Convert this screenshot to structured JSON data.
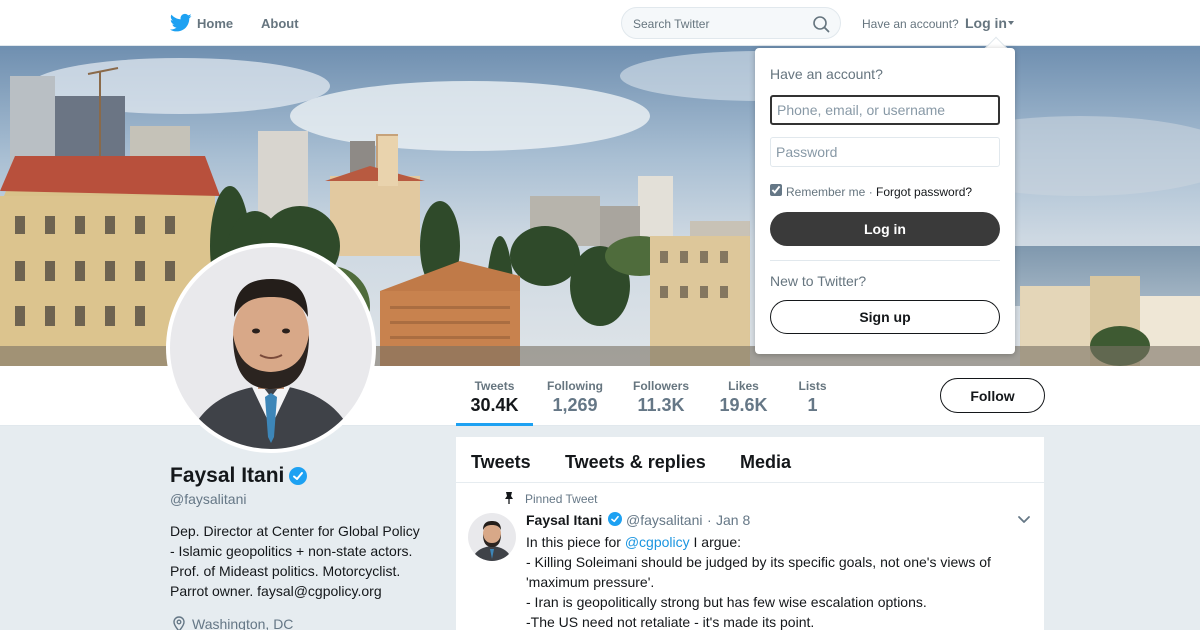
{
  "nav": {
    "home_label": "Home",
    "about_label": "About",
    "search_placeholder": "Search Twitter",
    "have_account": "Have an account?",
    "login_label": "Log in",
    "logo_icon": "twitter-bird-icon",
    "accent_color": "#1da1f2"
  },
  "profile": {
    "name": "Faysal Itani",
    "handle": "@faysalitani",
    "bio_lines": [
      "Dep. Director at Center for Global Policy",
      "- Islamic geopolitics + non-state actors.",
      "Prof. of Mideast politics. Motorcyclist.",
      "Parrot owner. faysal@cgpolicy.org"
    ],
    "location": "Washington, DC",
    "verified": true
  },
  "stats": [
    {
      "label": "Tweets",
      "value": "30.4K",
      "active": true
    },
    {
      "label": "Following",
      "value": "1,269"
    },
    {
      "label": "Followers",
      "value": "11.3K"
    },
    {
      "label": "Likes",
      "value": "19.6K"
    },
    {
      "label": "Lists",
      "value": "1"
    }
  ],
  "follow_label": "Follow",
  "timeline": {
    "tabs": [
      "Tweets",
      "Tweets & replies",
      "Media"
    ]
  },
  "pinned_tweet": {
    "pinned_label": "Pinned Tweet",
    "name": "Faysal Itani",
    "handle": "@faysalitani",
    "separator": "·",
    "date": "Jan 8",
    "text_line1_prefix": "In this piece for ",
    "text_line1_mention": "@cgpolicy",
    "text_line1_suffix": " I argue:",
    "text_lines": [
      "- Killing Soleimani should be judged by its specific goals, not one's views of",
      "'maximum pressure'.",
      "- Iran is geopolitically strong but has few wise escalation options.",
      "-The US need not retaliate - it's made its point."
    ]
  },
  "login_dropdown": {
    "title": "Have an account?",
    "username_placeholder": "Phone, email, or username",
    "password_placeholder": "Password",
    "remember_label": "Remember me",
    "separator": "·",
    "forgot_label": "Forgot password?",
    "login_button": "Log in",
    "new_to_twitter": "New to Twitter?",
    "signup_button": "Sign up",
    "remember_checked": true
  }
}
